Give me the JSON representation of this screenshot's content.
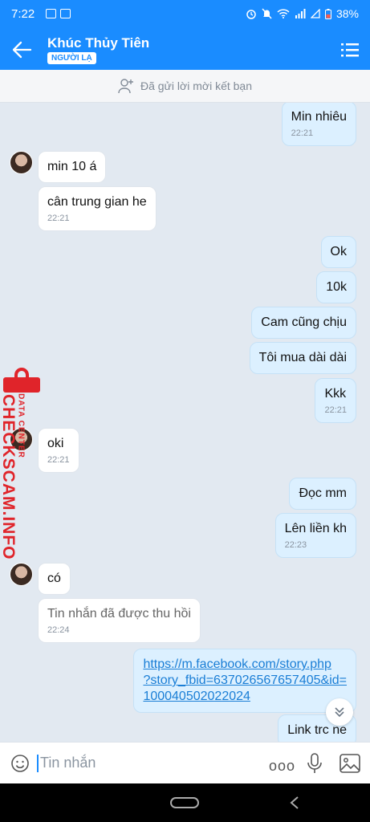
{
  "status_bar": {
    "time": "7:22",
    "battery": "38%"
  },
  "header": {
    "name": "Khúc Thủy Tiên",
    "badge": "NGƯỜI LẠ"
  },
  "friend_request": {
    "text": "Đã gửi lời mời kết bạn"
  },
  "messages": [
    {
      "side": "out",
      "text": "Min nhiêu",
      "time": "22:21"
    },
    {
      "side": "in",
      "text": "min 10 á",
      "time": ""
    },
    {
      "side": "in",
      "text": "cân trung gian he",
      "time": "22:21"
    },
    {
      "side": "out",
      "text": "Ok",
      "time": ""
    },
    {
      "side": "out",
      "text": "10k",
      "time": ""
    },
    {
      "side": "out",
      "text": "Cam cũng chịu",
      "time": ""
    },
    {
      "side": "out",
      "text": "Tôi mua dài dài",
      "time": ""
    },
    {
      "side": "out",
      "text": "Kkk",
      "time": "22:21"
    },
    {
      "side": "in",
      "text": "oki",
      "time": "22:21"
    },
    {
      "side": "out",
      "text": "Đọc mm",
      "time": ""
    },
    {
      "side": "out",
      "text": "Lên liền kh",
      "time": "22:23"
    },
    {
      "side": "in",
      "text": "có",
      "time": ""
    },
    {
      "side": "in",
      "text": "Tin nhắn đã được thu hồi",
      "time": "22:24"
    },
    {
      "side": "out",
      "link_lines": [
        "https://m.facebook.com/story.php",
        "?story_fbid=637026567657405&id=",
        "100040502022024"
      ],
      "time": ""
    },
    {
      "side": "out",
      "text": "Link trc ne",
      "time": ""
    }
  ],
  "input": {
    "placeholder": "Tin nhắn",
    "more": "ooo"
  },
  "watermark": {
    "brand": "CHECKSCAM.INFO",
    "sub": "DATA CENTER"
  },
  "icons": [
    "back-arrow-icon",
    "menu-icon",
    "add-friend-icon",
    "scroll-down-icon",
    "emoji-icon",
    "mic-icon",
    "gallery-icon",
    "lock-icon"
  ]
}
